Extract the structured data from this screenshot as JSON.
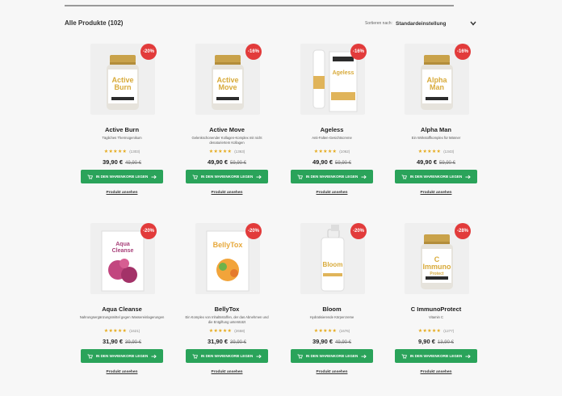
{
  "listing": {
    "title": "Alle Produkte (102)",
    "sort_label": "Sortieren nach:",
    "sort_value": "Standardeinstellung"
  },
  "colors": {
    "badge": "#e23b3b",
    "button": "#2aa35a",
    "stars": "#e5a91a"
  },
  "products": [
    {
      "name": "Active Burn",
      "desc": "Tägliches Thermogenikum",
      "badge": "-20%",
      "stars": "★★★★★",
      "count": "(1303)",
      "price": "39,90 €",
      "old": "49,90 €",
      "cart": "IN DEN WARENKORB LEGEN",
      "link": "Produkt ansehen",
      "type": "bottle",
      "label": "Active Burn"
    },
    {
      "name": "Active Move",
      "desc": "Gelenkschonender Kollagen-Komplex mit nicht denaturiertem Kollagen",
      "badge": "-16%",
      "stars": "★★★★★",
      "count": "(1363)",
      "price": "49,90 €",
      "old": "59,90 €",
      "cart": "IN DEN WARENKORB LEGEN",
      "link": "Produkt ansehen",
      "type": "bottle",
      "label": "Active Move"
    },
    {
      "name": "Ageless",
      "desc": "Anti-Falten-Gesichtscreme",
      "badge": "-16%",
      "stars": "★★★★★",
      "count": "(1062)",
      "price": "49,90 €",
      "old": "59,90 €",
      "cart": "IN DEN WARENKORB LEGEN",
      "link": "Produkt ansehen",
      "type": "serum",
      "label": "Ageless"
    },
    {
      "name": "Alpha Man",
      "desc": "Ein Wirkstoffkomplex für Männer",
      "badge": "-16%",
      "stars": "★★★★★",
      "count": "(1343)",
      "price": "49,90 €",
      "old": "59,90 €",
      "cart": "IN DEN WARENKORB LEGEN",
      "link": "Produkt ansehen",
      "type": "bottle",
      "label": "Alpha Man"
    },
    {
      "name": "Aqua Cleanse",
      "desc": "Nahrungsergänzungsmittel gegen Wassereinlagerungen",
      "badge": "-20%",
      "stars": "★★★★★",
      "count": "(1621)",
      "price": "31,90 €",
      "old": "39,90 €",
      "cart": "IN DEN WARENKORB LEGEN",
      "link": "Produkt ansehen",
      "type": "box",
      "label": "Aqua Cleanse"
    },
    {
      "name": "BellyTox",
      "desc": "Ein Komplex von Inhaltsstoffen, der das Abnehmen und die Entgiftung unterstützt",
      "badge": "-20%",
      "stars": "★★★★★",
      "count": "(2658)",
      "price": "31,90 €",
      "old": "39,90 €",
      "cart": "IN DEN WARENKORB LEGEN",
      "link": "Produkt ansehen",
      "type": "box2",
      "label": "BellyTox"
    },
    {
      "name": "Bloom",
      "desc": "Hydratisierende Körpercreme",
      "badge": "-20%",
      "stars": "★★★★★",
      "count": "(1676)",
      "price": "39,90 €",
      "old": "49,90 €",
      "cart": "IN DEN WARENKORB LEGEN",
      "link": "Produkt ansehen",
      "type": "pump",
      "label": "Bloom"
    },
    {
      "name": "C ImmunoProtect",
      "desc": "Vitamin C",
      "badge": "-28%",
      "stars": "★★★★★",
      "count": "(1277)",
      "price": "9,90 €",
      "old": "13,90 €",
      "cart": "IN DEN WARENKORB LEGEN",
      "link": "Produkt ansehen",
      "type": "bottle",
      "label": "C Immuno Protect"
    }
  ]
}
